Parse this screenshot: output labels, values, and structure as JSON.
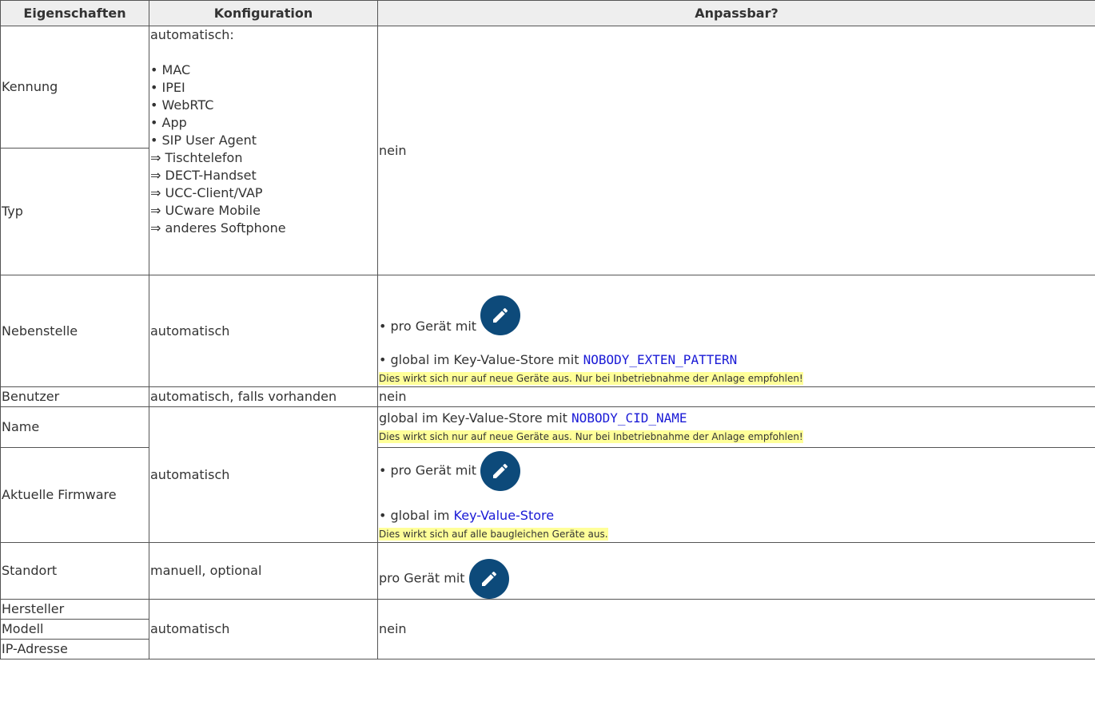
{
  "headers": {
    "eigenschaften": "Eigenschaften",
    "konfiguration": "Konfiguration",
    "anpassbar": "Anpassbar?"
  },
  "rows": {
    "kennung": {
      "label": "Kennung"
    },
    "typ": {
      "label": "Typ"
    },
    "kennung_typ_config": {
      "intro": "automatisch:",
      "items": [
        "• MAC",
        "• IPEI",
        "• WebRTC",
        "• App",
        "• SIP User Agent",
        "⇒ Tischtelefon",
        "⇒ DECT-Handset",
        "⇒ UCC-Client/VAP",
        "⇒ UCware Mobile",
        "⇒ anderes Softphone"
      ],
      "anpassbar": "nein"
    },
    "nebenstelle": {
      "label": "Nebenstelle",
      "config": "automatisch",
      "line1": "• pro Gerät mit",
      "line2": "• global im Key-Value-Store mit",
      "code": "NOBODY_EXTEN_PATTERN",
      "note": "Dies wirkt sich nur auf neue Geräte aus. Nur bei Inbetriebnahme der Anlage empfohlen!"
    },
    "benutzer": {
      "label": "Benutzer",
      "config": "automatisch, falls vorhanden",
      "anpassbar": "nein"
    },
    "name": {
      "label": "Name",
      "line1": "global im Key-Value-Store mit",
      "code": "NOBODY_CID_NAME",
      "note": "Dies wirkt sich nur auf neue Geräte aus. Nur bei Inbetriebnahme der Anlage empfohlen!"
    },
    "name_firmware_config": "automatisch",
    "firmware": {
      "label": "Aktuelle Firmware",
      "line1": "• pro Gerät mit",
      "line2": "• global im",
      "link": "Key-Value-Store",
      "note": "Dies wirkt sich auf alle baugleichen Geräte aus."
    },
    "standort": {
      "label": "Standort",
      "config": "manuell, optional",
      "line1": "pro Gerät mit"
    },
    "hersteller": {
      "label": "Hersteller"
    },
    "modell": {
      "label": "Modell"
    },
    "ip": {
      "label": "IP-Adresse"
    },
    "hw_config": "automatisch",
    "hw_anpassbar": "nein"
  },
  "icons": {
    "edit": "pencil-edit-icon",
    "edit_color": "#0d4a7a"
  }
}
